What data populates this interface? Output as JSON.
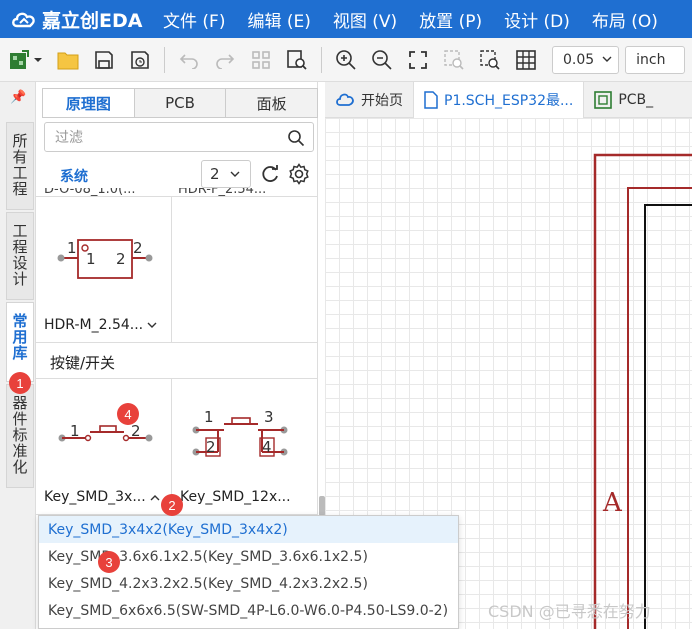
{
  "app": {
    "logo_text": "嘉立创EDA"
  },
  "menu": [
    "文件 (F)",
    "编辑 (E)",
    "视图 (V)",
    "放置 (P)",
    "设计 (D)",
    "布局 (O)"
  ],
  "toolbar": {
    "icons": [
      "new-project-icon",
      "chevron-down-icon",
      "open-folder-icon",
      "save-icon",
      "save-as-icon",
      "undo-icon",
      "redo-icon",
      "grid-layout-icon",
      "find-icon",
      "zoom-in-icon",
      "zoom-out-icon",
      "fit-view-icon",
      "fit-selection-icon",
      "select-area-icon",
      "grid-icon"
    ],
    "grid_size": "0.05",
    "unit": "inch"
  },
  "left_tabs": {
    "all_projects": "所有工程",
    "project_design": "工程设计",
    "common_library": "常用库",
    "device_standardization": "器件标准化"
  },
  "library": {
    "tabs": [
      "原理图",
      "PCB",
      "面板"
    ],
    "active_tab": 0,
    "filter_placeholder": "过滤",
    "system_label": "系统",
    "page_value": "2",
    "partial_top_left": "D-O-08_1.0(...",
    "partial_top_right": "HDR-F_2.54...",
    "hdr_label": "HDR-M_2.54...",
    "section_title": "按键/开关",
    "key_left_label": "Key_SMD_3x...",
    "key_right_label": "Key_SMD_12x...",
    "pin_labels": {
      "hdr": [
        "1",
        "1",
        "2",
        "2"
      ],
      "key_left": [
        "1",
        "2"
      ],
      "key_right": [
        "1",
        "2",
        "3",
        "4"
      ]
    }
  },
  "doc_tabs": [
    "开始页",
    "P1.SCH_ESP32最...",
    "PCB_"
  ],
  "canvas": {
    "frame_letter": "A"
  },
  "dropdown_items": [
    "Key_SMD_3x4x2(Key_SMD_3x4x2)",
    "Key_SMD_3.6x6.1x2.5(Key_SMD_3.6x6.1x2.5)",
    "Key_SMD_4.2x3.2x2.5(Key_SMD_4.2x3.2x2.5)",
    "Key_SMD_6x6x6.5(SW-SMD_4P-L6.0-W6.0-P4.50-LS9.0-2)"
  ],
  "markers": [
    "1",
    "2",
    "3",
    "4"
  ],
  "watermark": "CSDN @已寻悉在努力",
  "colors": {
    "brand_blue": "#1f6fd1",
    "schematic_red": "#a52a2a",
    "marker_red": "#e8413b",
    "pin_gray": "#999999"
  }
}
